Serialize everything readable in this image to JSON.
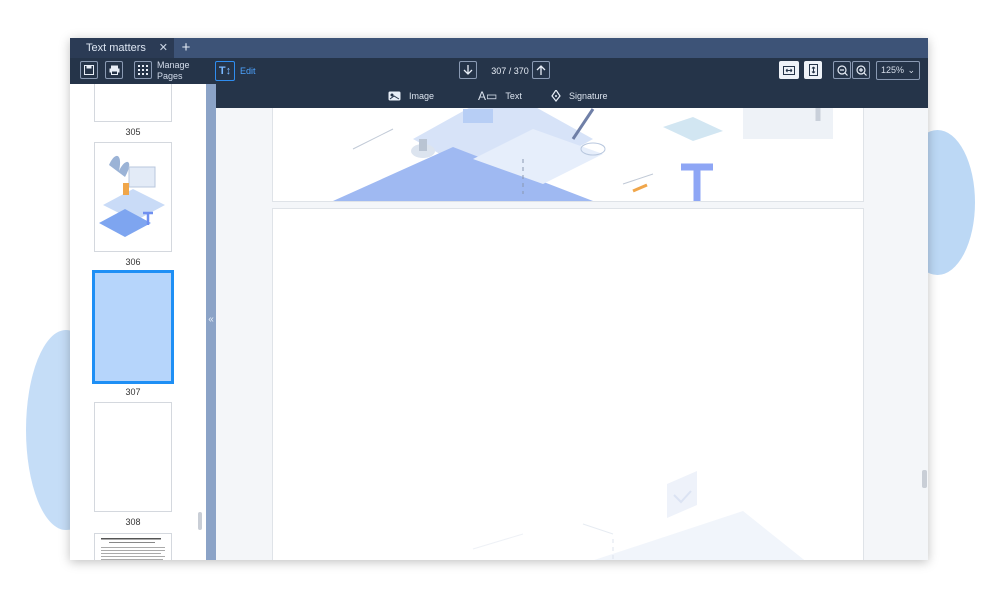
{
  "colors": {
    "tab_bar": "#3d5377",
    "toolbar": "#253449",
    "accent": "#2f8df0",
    "selected_thumb": "#b6d5fb",
    "sidebar_rail": "#8ba3c7"
  },
  "tab": {
    "title": "Text matters",
    "close_icon": "close-icon",
    "add_icon": "plus-icon"
  },
  "toolbar": {
    "manage_pages_line1": "Manage",
    "manage_pages_line2": "Pages",
    "edit_label": "Edit",
    "page_current": "307",
    "page_total": "370",
    "page_indicator": "307 / 370",
    "zoom": "125%"
  },
  "subtoolbar": {
    "image_label": "Image",
    "text_label": "Text",
    "signature_label": "Signature"
  },
  "thumbnails": [
    {
      "number": "305",
      "selected": false
    },
    {
      "number": "306",
      "selected": false
    },
    {
      "number": "307",
      "selected": true
    },
    {
      "number": "308",
      "selected": false
    }
  ],
  "thumb_309_text": "The European Process of Art Navigation"
}
